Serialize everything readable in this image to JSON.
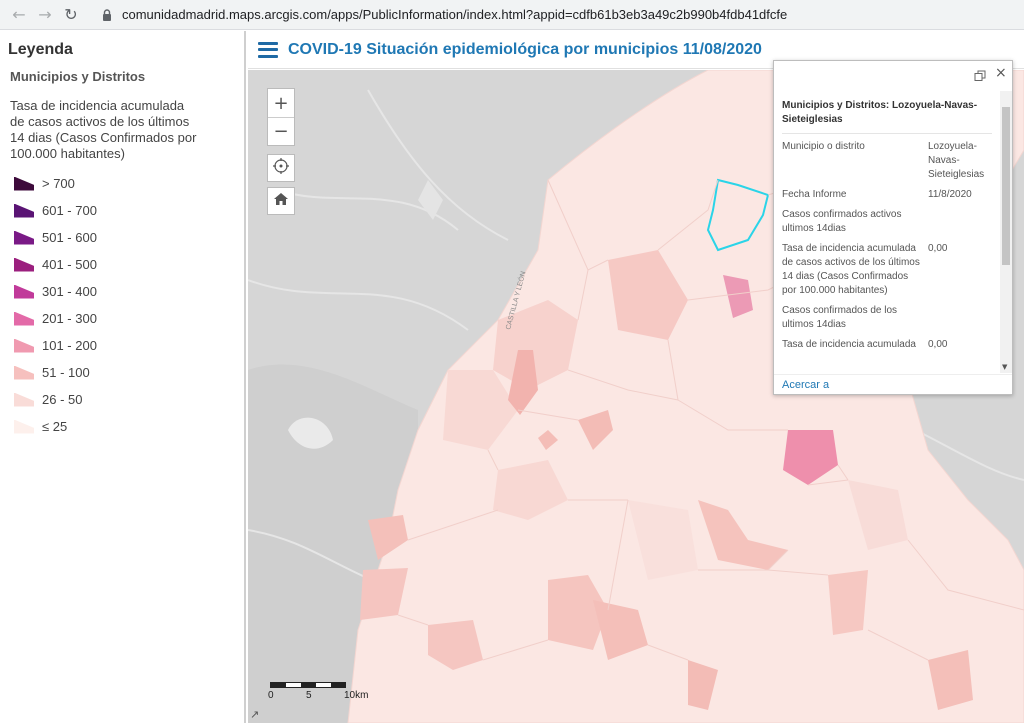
{
  "browser": {
    "back_icon": "arrow-left-icon",
    "forward_icon": "arrow-right-icon",
    "reload_icon": "reload-icon",
    "url": "comunidadmadrid.maps.arcgis.com/apps/PublicInformation/index.html?appid=cdfb61b3eb3a49c2b990b4fdb41dfcfe"
  },
  "legend": {
    "title": "Leyenda",
    "layer_name": "Municipios y Distritos",
    "field_label": "Tasa de incidencia acumulada de casos activos de los últimos 14 dias (Casos Confirmados por 100.000 habitantes)",
    "items": [
      {
        "label": "> 700",
        "color": "#3d0a3b"
      },
      {
        "label": "601 - 700",
        "color": "#5a1474"
      },
      {
        "label": "501 - 600",
        "color": "#7a1a86"
      },
      {
        "label": "401 - 500",
        "color": "#9b1f7e"
      },
      {
        "label": "301 - 400",
        "color": "#c13a9a"
      },
      {
        "label": "201 - 300",
        "color": "#e36aa8"
      },
      {
        "label": "101 - 200",
        "color": "#f09ab0"
      },
      {
        "label": "51 - 100",
        "color": "#f6c0be"
      },
      {
        "label": "26 - 50",
        "color": "#f9dcd8"
      },
      {
        "label": "≤ 25",
        "color": "#fdf0ec"
      }
    ]
  },
  "header": {
    "title": "COVID-19 Situación epidemiológica por municipios 11/08/2020"
  },
  "map": {
    "road_label": "CASTILLA Y LEÓN",
    "zoom_in": "+",
    "zoom_out": "−",
    "scale_labels": [
      "0",
      "5",
      "10km"
    ]
  },
  "popup": {
    "heading": "Municipios y Distritos: Lozoyuela-Navas-Sieteiglesias",
    "attributes": [
      {
        "key": "Municipio o distrito",
        "value": "Lozoyuela-Navas-Sieteiglesias"
      },
      {
        "key": "Fecha Informe",
        "value": "11/8/2020"
      },
      {
        "key": "Casos confirmados activos ultimos 14dias",
        "value": ""
      },
      {
        "key": "Tasa de incidencia acumulada de casos activos de los últimos 14 dias (Casos Confirmados por 100.000 habitantes)",
        "value": "0,00"
      },
      {
        "key": "Casos confirmados de los ultimos 14dias",
        "value": ""
      },
      {
        "key": "Tasa de incidencia acumulada",
        "value": "0,00"
      }
    ],
    "link": "Acercar a",
    "close": "×"
  }
}
